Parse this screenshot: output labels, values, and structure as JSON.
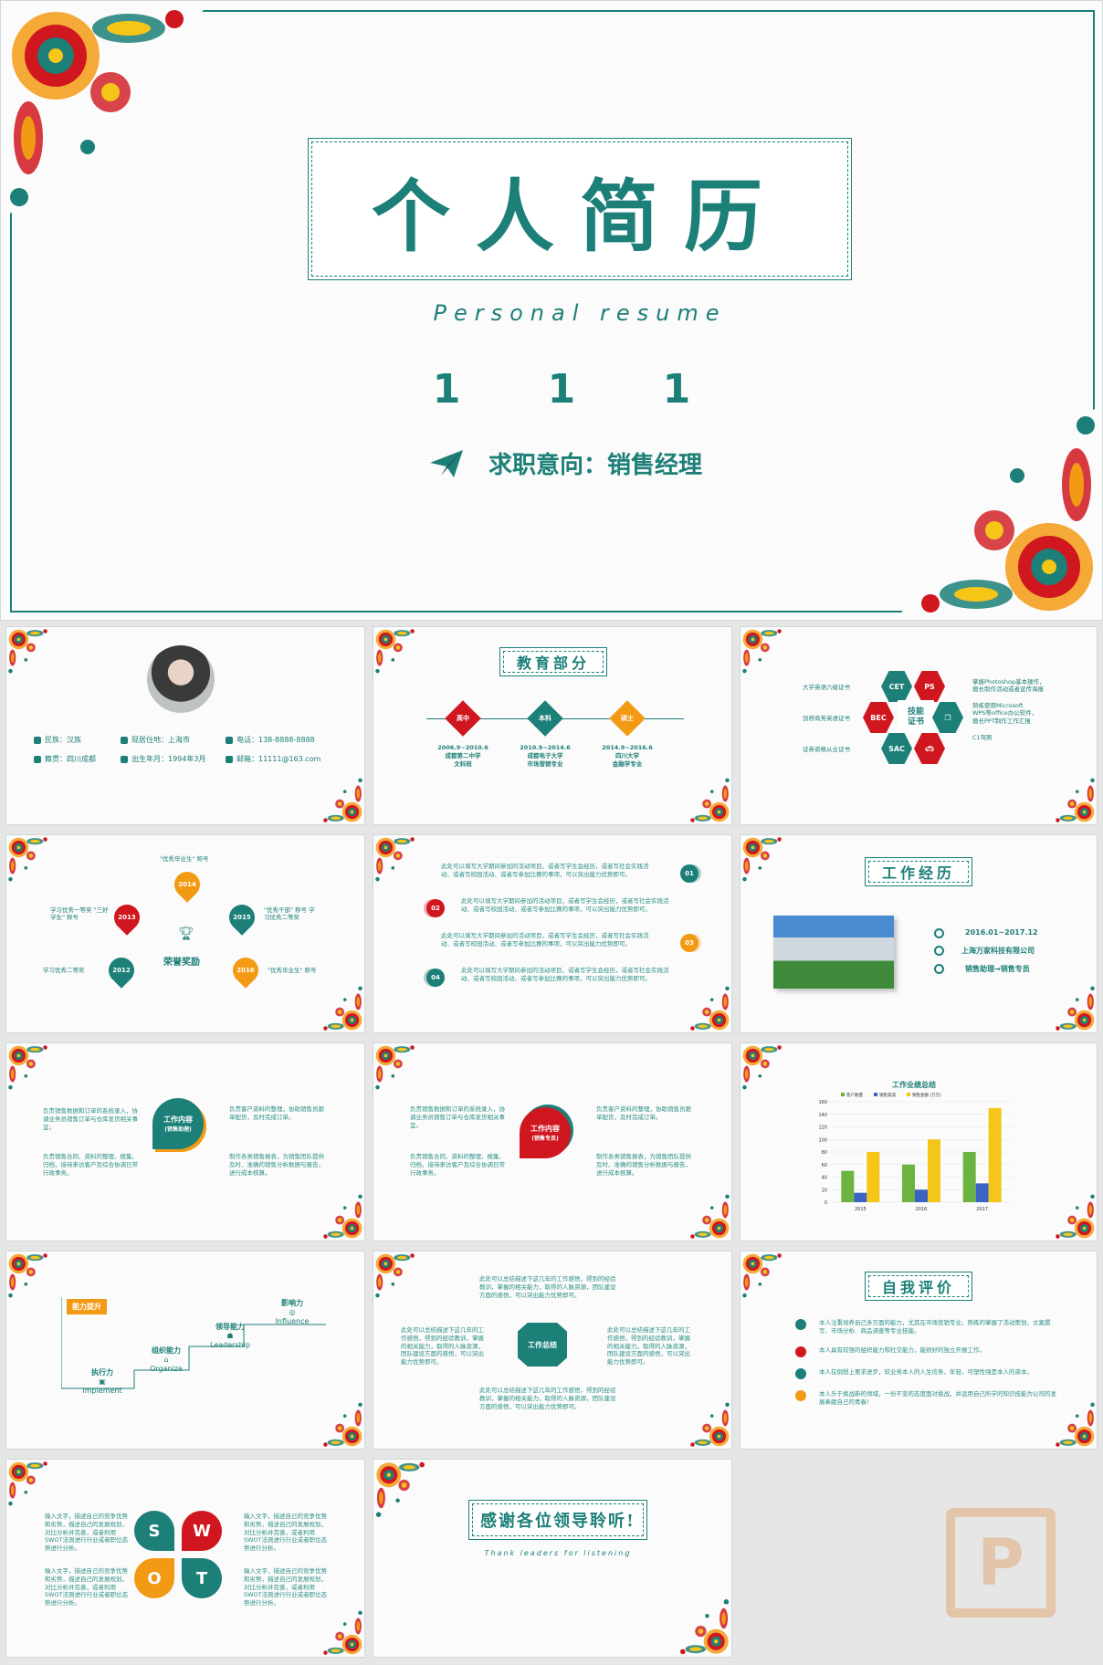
{
  "colors": {
    "teal": "#1c7f78",
    "red": "#d0161e",
    "orange": "#f39a14",
    "green": "#6db33f",
    "blue": "#3a63c4",
    "yellow": "#f5c518"
  },
  "cover": {
    "title": "个人简历",
    "subtitle": "Personal resume",
    "number": "1 1 1",
    "intent": "求职意向：销售经理"
  },
  "profile": {
    "items": [
      {
        "icon": "person-icon",
        "text": "民族：汉族"
      },
      {
        "icon": "location-icon",
        "text": "现居住地：上海市"
      },
      {
        "icon": "phone-icon",
        "text": "电话：138-8888-8888"
      },
      {
        "icon": "home-icon",
        "text": "籍贯：四川成都"
      },
      {
        "icon": "calendar-icon",
        "text": "出生年月：1994年3月"
      },
      {
        "icon": "mail-icon",
        "text": "邮箱：11111@163.com"
      }
    ]
  },
  "education": {
    "title": "教育部分",
    "stages": [
      {
        "label": "高中",
        "color": "#d0161e",
        "date": "2006.9~2010.6",
        "school": "成都第二中学",
        "major": "文科班"
      },
      {
        "label": "本科",
        "color": "#1c7f78",
        "date": "2010.9~2014.6",
        "school": "成都电子大学",
        "major": "市场营销专业"
      },
      {
        "label": "硕士",
        "color": "#f39a14",
        "date": "2014.9~2016.6",
        "school": "四川大学",
        "major": "金融学专业"
      }
    ]
  },
  "skills": {
    "center": "技能证书",
    "hexes": [
      {
        "label": "CET",
        "color": "#1c7f78"
      },
      {
        "label": "PS",
        "color": "#d0161e"
      },
      {
        "label": "BEC",
        "color": "#d0161e"
      },
      {
        "label": "SAC",
        "color": "#1c7f78"
      }
    ],
    "left": [
      "大学英语六级证书",
      "剑桥商务英语证书",
      "证券资格从业证书"
    ],
    "right": [
      "掌握Photoshop基本操作，",
      "擅长制作活动或者宣传海报",
      "熟练使用Microsoft",
      "WPS等office办公软件，",
      "擅长PPT制作工作汇报",
      "C1驾照"
    ]
  },
  "honors": {
    "center": "荣誉奖励",
    "years": [
      {
        "year": "2014",
        "color": "#f39a14",
        "text": "\"优秀毕业生\" 称号"
      },
      {
        "year": "2013",
        "color": "#d0161e",
        "text": "学习优秀一等奖 \"三好学生\" 称号"
      },
      {
        "year": "2015",
        "color": "#1c7f78",
        "text": "\"优秀干部\" 称号 学习优秀二等奖"
      },
      {
        "year": "2012",
        "color": "#1c7f78",
        "text": "学习优秀二等奖"
      },
      {
        "year": "2016",
        "color": "#f39a14",
        "text": "\"优秀毕业生\" 称号"
      }
    ]
  },
  "activities": {
    "items": [
      {
        "num": "01",
        "text": "此处可以填写大学期间参加的活动项目，或者写学生会经历，或者写社会实践活动、或者写校园活动、或者写参加比赛的事项，可以突出能力优势即可。"
      },
      {
        "num": "02",
        "text": "此处可以填写大学期间参加的活动项目，或者写学生会经历，或者写社会实践活动、或者写校园活动、或者写参加比赛的事项，可以突出能力优势即可。"
      },
      {
        "num": "03",
        "text": "此处可以填写大学期间参加的活动项目，或者写学生会经历，或者写社会实践活动、或者写校园活动、或者写参加比赛的事项，可以突出能力优势即可。"
      },
      {
        "num": "04",
        "text": "此处可以填写大学期间参加的活动项目，或者写学生会经历，或者写社会实践活动、或者写校园活动、或者写参加比赛的事项，可以突出能力优势即可。"
      }
    ]
  },
  "work": {
    "title": "工作经历",
    "date": "2016.01~2017.12",
    "company": "上海万家科技有限公司",
    "role": "销售助理→销售专员"
  },
  "content1": {
    "center": "工作内容",
    "sub": "(销售助理)",
    "items": [
      "负责销售数据和订单的系统录入，协调业务员销售订单与仓库发货相关事宜。",
      "负责客户资料的整理，协助销售员跟单配货，及时完成订单。",
      "负责销售合同、资料的整理、搜集、归档，接待来访客户及综合协调日常行政事务。",
      "制作各类销售报表，为销售团队提供及时、准确的销售分析数据与报告，进行成本核算。"
    ]
  },
  "content2": {
    "center": "工作内容",
    "sub": "(销售专员)",
    "items": [
      "负责销售数据和订单的系统录入，协调业务员销售订单与仓库发货相关事宜。",
      "负责客户资料的整理，协助销售员跟单配货，及时完成订单。",
      "负责销售合同、资料的整理、搜集、归档，接待来访客户及综合协调日常行政事务。",
      "制作各类销售报表，为销售团队提供及时、准确的销售分析数据与报告，进行成本核算。"
    ]
  },
  "chart_data": {
    "type": "bar",
    "title": "工作业绩总结",
    "categories": [
      "2015",
      "2016",
      "2017"
    ],
    "series": [
      {
        "name": "客户数量",
        "color": "#6db33f",
        "values": [
          50,
          60,
          80
        ]
      },
      {
        "name": "销售渠道",
        "color": "#3a63c4",
        "values": [
          15,
          20,
          30
        ]
      },
      {
        "name": "销售金额 (万元)",
        "color": "#f5c518",
        "values": [
          80,
          100,
          150
        ]
      }
    ],
    "ylim": [
      0,
      160
    ],
    "yticks": [
      "0",
      "20",
      "40",
      "60",
      "80",
      "100",
      "120",
      "140",
      "160"
    ]
  },
  "ability": {
    "badge": "能力提升",
    "steps": [
      {
        "cn": "执行力",
        "en": "Implement"
      },
      {
        "cn": "组织能力",
        "en": "Organize"
      },
      {
        "cn": "领导能力",
        "en": "Leadership"
      },
      {
        "cn": "影响力",
        "en": "Influence"
      }
    ]
  },
  "summary": {
    "center": "工作总结",
    "top": "此处可以总结描述下这几年的工作感悟，得到的经验教训，掌握的相关能力，取得的人脉资源，团队建设方面的感悟，可以突出能力优势即可。",
    "left": "此处可以总结描述下这几年的工作感悟，得到的经验教训，掌握的相关能力，取得的人脉资源，团队建设方面的感悟，可以突出能力优势即可。",
    "right": "此处可以总结描述下这几年的工作感悟，得到的经验教训，掌握的相关能力，取得的人脉资源，团队建设方面的感悟，可以突出能力优势即可。",
    "bottom": "此处可以总结描述下这几年的工作感悟，得到的经验教训，掌握的相关能力，取得的人脉资源，团队建设方面的感悟，可以突出能力优势即可。"
  },
  "evaluation": {
    "title": "自我评价",
    "items": [
      {
        "color": "#1c7f78",
        "text": "本人注重培养自己多方面的能力，尤其在市场营销专业，熟练的掌握了活动策划、文案撰写、市场分析、商品调查等专业技能。"
      },
      {
        "color": "#d0161e",
        "text": "本人具有较强的组织能力和社交能力，能很好的独立开展工作。"
      },
      {
        "color": "#1c7f78",
        "text": "本人在倒想上要求进步，较业务本人的人生信条，年轻，可塑性强是本人的资本。"
      },
      {
        "color": "#f39a14",
        "text": "本人乐于挑战新的领域，一份不变的态度面对挑战，并运用自己所学的知识技能为公司的发展奉献自己的青春！"
      }
    ]
  },
  "swot": {
    "letters": [
      {
        "l": "S",
        "color": "#1c7f78"
      },
      {
        "l": "W",
        "color": "#d0161e"
      },
      {
        "l": "O",
        "color": "#f39a14"
      },
      {
        "l": "T",
        "color": "#1c7f78"
      }
    ],
    "text": "输入文字，描述自己的竞争优势和劣势，描述自己的发展规划，对比分析并完善，或者利用SWOT法则进行行业或者职位态势进行分析。"
  },
  "thanks": {
    "title": "感谢各位领导聆听!",
    "sub": "Thank leaders for listening"
  },
  "watermark": "P"
}
